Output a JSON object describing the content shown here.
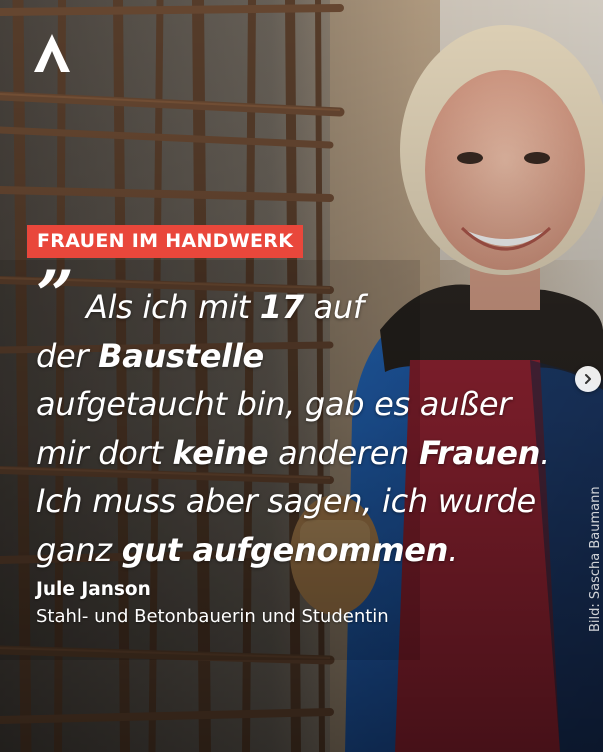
{
  "post": {
    "tag": "FRAUEN IM HANDWERK",
    "quote_mark": "”",
    "quote": {
      "l1a": "Als ich mit ",
      "l1b": "17",
      "l1c": " auf",
      "l2a": "der ",
      "l2b": "Baustelle",
      "l3": "aufgetaucht bin, gab es außer",
      "l4a": "mir dort ",
      "l4b": "keine",
      "l4c": " anderen ",
      "l4d": "Frauen",
      "l4e": ".",
      "l5": "Ich muss aber sagen, ich wurde",
      "l6a": "ganz ",
      "l6b": "gut aufgenommen",
      "l6c": "."
    },
    "author": "Jule Janson",
    "role": "Stahl- und Betonbauerin und Studentin",
    "credit": "Bild: Sascha Baumann"
  },
  "icons": {
    "logo": "chevron-a-logo",
    "next": "chevron-right-icon"
  },
  "colors": {
    "tag_background": "#e9473b",
    "text": "#ffffff",
    "jacket_blue": "#1f63c4",
    "next_button": "#ffffff"
  }
}
